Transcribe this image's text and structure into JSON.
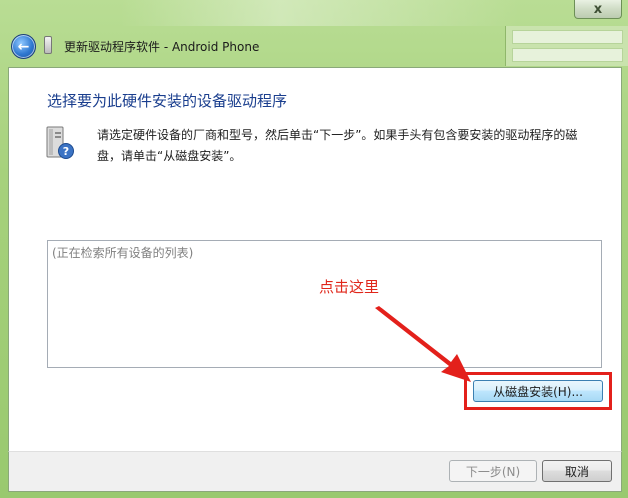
{
  "window": {
    "title": "更新驱动程序软件 - Android Phone",
    "close_glyph": "x"
  },
  "page": {
    "heading": "选择要为此硬件安装的设备驱动程序",
    "description": "请选定硬件设备的厂商和型号，然后单击“下一步”。如果手头有包含要安装的驱动程序的磁盘，请单击“从磁盘安装”。"
  },
  "device_list": {
    "status": "(正在检索所有设备的列表)"
  },
  "buttons": {
    "have_disk": "从磁盘安装(H)...",
    "next": "下一步(N)",
    "cancel": "取消"
  },
  "annotation": {
    "text": "点击这里",
    "color": "#e0261a"
  },
  "icons": {
    "back": "back-arrow-icon",
    "device": "phone-device-icon",
    "hardware": "hardware-help-icon"
  }
}
